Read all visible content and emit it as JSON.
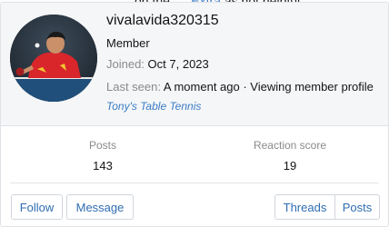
{
  "background": {
    "text_prefix": "on the",
    "text_link": "Extra",
    "text_suffix": "as not helpful"
  },
  "profile": {
    "username": "vivalavida320315",
    "role": "Member",
    "joined_label": "Joined:",
    "joined_value": "Oct 7, 2023",
    "last_seen_label": "Last seen:",
    "last_seen_value": "A moment ago · Viewing member profile",
    "signature_link": "Tony's Table Tennis",
    "avatar_alt": "avatar"
  },
  "stats": {
    "posts_label": "Posts",
    "posts_value": "143",
    "reaction_label": "Reaction score",
    "reaction_value": "19"
  },
  "actions": {
    "follow": "Follow",
    "message": "Message",
    "threads": "Threads",
    "posts": "Posts"
  },
  "colors": {
    "link": "#3b7cc4",
    "button_text": "#2f6db3",
    "header_bg": "#f5f6f8",
    "jersey_red": "#d8262b"
  }
}
